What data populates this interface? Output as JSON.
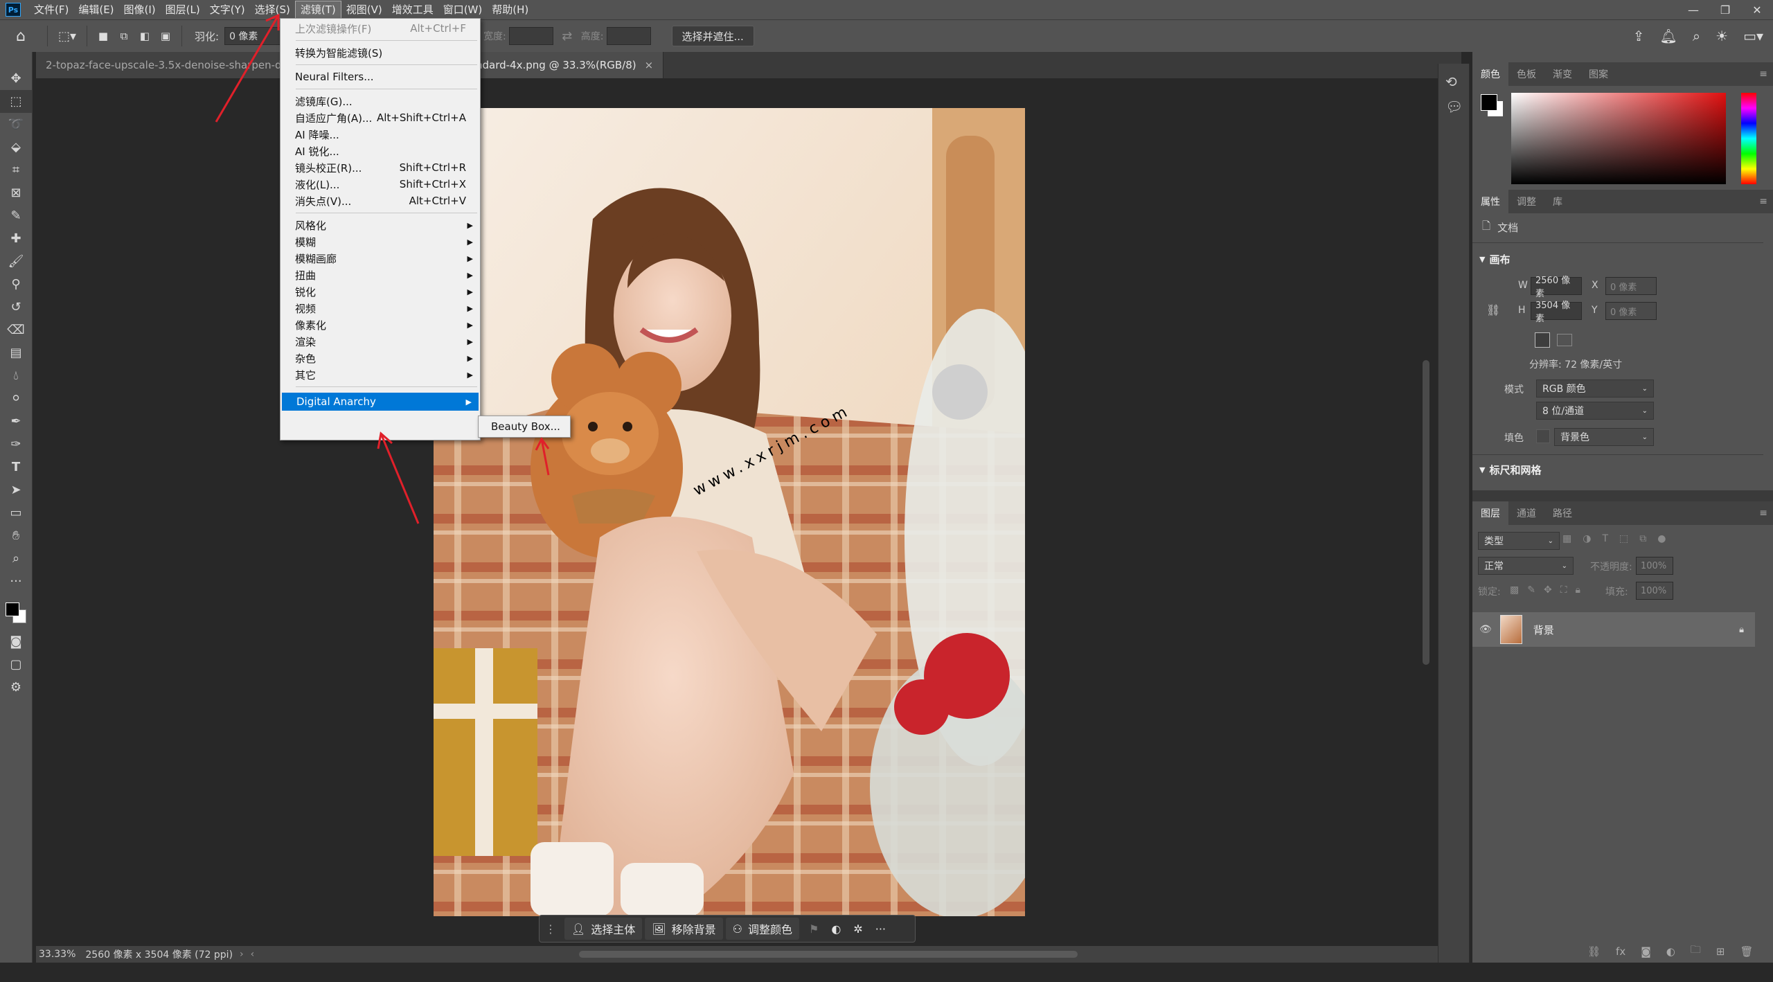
{
  "menubar": {
    "items": [
      "文件(F)",
      "编辑(E)",
      "图像(I)",
      "图层(L)",
      "文字(Y)",
      "选择(S)",
      "滤镜(T)",
      "视图(V)",
      "增效工具",
      "窗口(W)",
      "帮助(H)"
    ],
    "active_index": 6
  },
  "options": {
    "feather_label": "羽化:",
    "feather_value": "0 像素",
    "width_label": "宽度:",
    "height_label": "高度:",
    "select_mask_button": "选择并遮住..."
  },
  "tabs": [
    {
      "label": "2-topaz-face-upscale-3.5x-denoise-sharpen-denois",
      "active": false
    },
    {
      "label": "x_upscayl-standard-4x.png @ 33.3%(RGB/8)",
      "active": true,
      "close": "×"
    }
  ],
  "filter_menu": {
    "items": [
      {
        "label": "上次滤镜操作(F)",
        "shortcut": "Alt+Ctrl+F",
        "disabled": true
      },
      {
        "sep": true
      },
      {
        "label": "转换为智能滤镜(S)"
      },
      {
        "sep": true
      },
      {
        "label": "Neural Filters..."
      },
      {
        "sep": true
      },
      {
        "label": "滤镜库(G)..."
      },
      {
        "label": "自适应广角(A)...",
        "shortcut": "Alt+Shift+Ctrl+A"
      },
      {
        "label": "AI 降噪..."
      },
      {
        "label": "AI 锐化..."
      },
      {
        "label": "镜头校正(R)...",
        "shortcut": "Shift+Ctrl+R"
      },
      {
        "label": "液化(L)...",
        "shortcut": "Shift+Ctrl+X"
      },
      {
        "label": "消失点(V)...",
        "shortcut": "Alt+Ctrl+V"
      },
      {
        "sep": true
      },
      {
        "label": "风格化",
        "submenu": true
      },
      {
        "label": "模糊",
        "submenu": true
      },
      {
        "label": "模糊画廊",
        "submenu": true
      },
      {
        "label": "扭曲",
        "submenu": true
      },
      {
        "label": "锐化",
        "submenu": true
      },
      {
        "label": "视频",
        "submenu": true
      },
      {
        "label": "像素化",
        "submenu": true
      },
      {
        "label": "渲染",
        "submenu": true
      },
      {
        "label": "杂色",
        "submenu": true
      },
      {
        "label": "其它",
        "submenu": true
      },
      {
        "sep": true
      },
      {
        "label": "Digital Anarchy",
        "submenu": true,
        "highlighted": true
      }
    ],
    "submenu_item": "Beauty Box..."
  },
  "watermark": "www.xxrjm.com",
  "context_bar": {
    "select_subject": "选择主体",
    "remove_bg": "移除背景",
    "adjust_color": "调整颜色"
  },
  "status": {
    "zoom": "33.33%",
    "doc_info": "2560 像素 x 3504 像素 (72 ppi)"
  },
  "color_panel": {
    "tabs": [
      "颜色",
      "色板",
      "渐变",
      "图案"
    ]
  },
  "properties_panel": {
    "tabs": [
      "属性",
      "调整",
      "库"
    ],
    "doc_label": "文档",
    "canvas_header": "画布",
    "w_label": "W",
    "w_value": "2560 像素",
    "h_label": "H",
    "h_value": "3504 像素",
    "x_label": "X",
    "x_placeholder": "0 像素",
    "y_label": "Y",
    "y_placeholder": "0 像素",
    "resolution": "分辨率: 72 像素/英寸",
    "mode_label": "模式",
    "mode_value": "RGB 颜色",
    "depth_value": "8 位/通道",
    "fill_label": "填色",
    "fill_value": "背景色",
    "rulers_header": "标尺和网格"
  },
  "layers_panel": {
    "tabs": [
      "图层",
      "通道",
      "路径"
    ],
    "filter_placeholder": "类型",
    "blend_mode": "正常",
    "opacity_label": "不透明度:",
    "opacity_value": "100%",
    "lock_label": "锁定:",
    "fill_label": "填充:",
    "fill_value": "100%",
    "layer_name": "背景"
  },
  "colors": {
    "accent": "#0078d7",
    "annotation": "#e0202a"
  }
}
